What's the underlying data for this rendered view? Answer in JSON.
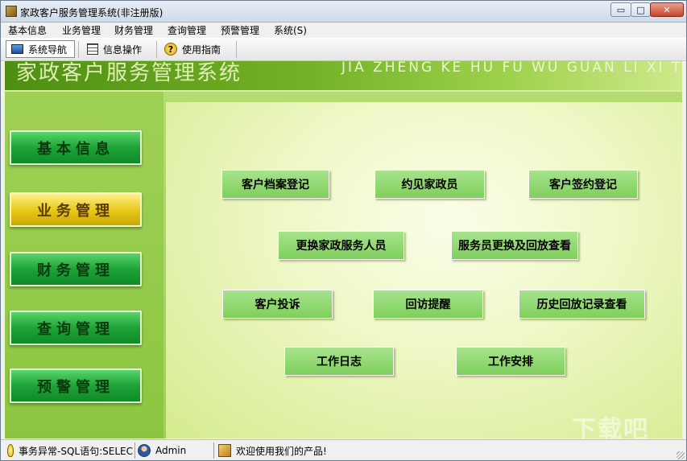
{
  "window": {
    "title": "家政客户服务管理系统(非注册版)",
    "controls": {
      "minimize": "▭",
      "maximize": "□",
      "close": "✕"
    }
  },
  "menu": [
    "基本信息",
    "业务管理",
    "财务管理",
    "查询管理",
    "预警管理",
    "系统(S)"
  ],
  "toolbar": {
    "items": [
      {
        "label": "系统导航",
        "icon": "monitor-icon",
        "active": true
      },
      {
        "label": "信息操作",
        "icon": "grid-icon"
      },
      {
        "label": "使用指南",
        "icon": "help-icon",
        "glyph": "?"
      }
    ]
  },
  "banner": {
    "title": "家政客户服务管理系统",
    "pinyin": "JIA ZHENG KE HU FU WU GUAN LI XI TONG"
  },
  "sidebar": {
    "items": [
      "基本信息",
      "业务管理",
      "财务管理",
      "查询管理",
      "预警管理"
    ],
    "active_index": 1
  },
  "functions": {
    "buttons": [
      "客户档案登记",
      "约见家政员",
      "客户签约登记",
      "更换家政服务人员",
      "服务员更换及回放查看",
      "客户投诉",
      "回访提醒",
      "历史回放记录查看",
      "工作日志",
      "工作安排"
    ]
  },
  "watermark": "下载吧",
  "status": {
    "message": "事务异常-SQL语句:SELEC",
    "user": "Admin",
    "welcome": "欢迎使用我们的产品!"
  },
  "colors": {
    "banner_dark": "#4e8f12",
    "nav_green": "#1ea338",
    "nav_active_yellow": "#e6c615",
    "func_button": "#8fd66f"
  }
}
